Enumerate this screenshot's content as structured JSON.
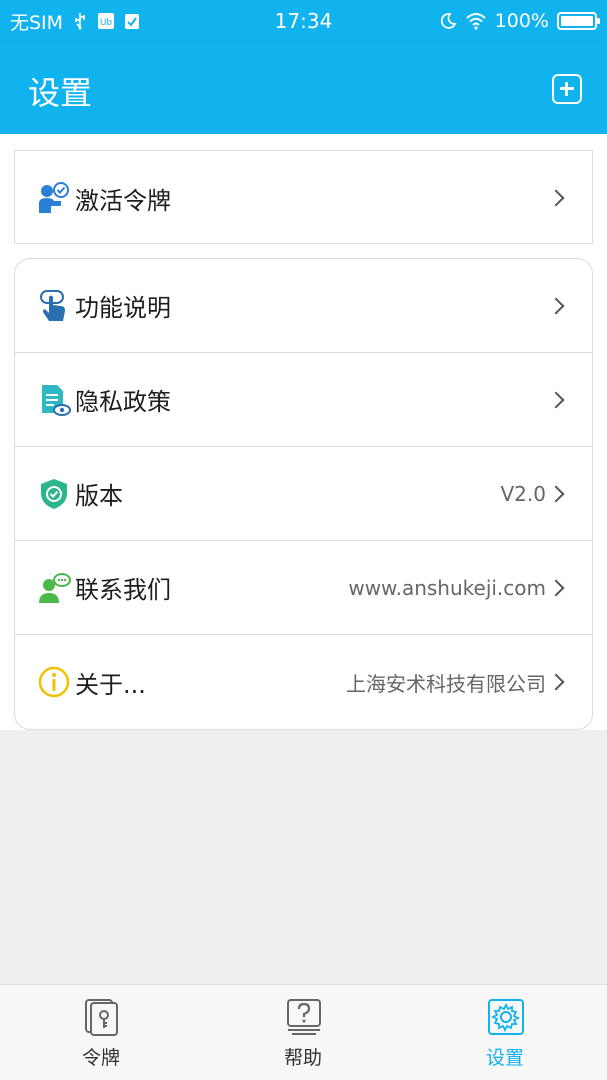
{
  "status_bar": {
    "carrier": "无SIM",
    "time": "17:34",
    "battery": "100%"
  },
  "header": {
    "title": "设置",
    "add_icon": "plus-square-icon"
  },
  "settings": {
    "activate": {
      "label": "激活令牌",
      "icon": "activate-token-icon"
    },
    "items": [
      {
        "label": "功能说明",
        "value": "",
        "icon": "touch-hand-icon"
      },
      {
        "label": "隐私政策",
        "value": "",
        "icon": "document-eye-icon"
      },
      {
        "label": "版本",
        "value": "V2.0",
        "icon": "shield-check-icon"
      },
      {
        "label": "联系我们",
        "value": "www.anshukeji.com",
        "icon": "contact-user-icon"
      },
      {
        "label": "关于...",
        "value": "上海安术科技有限公司",
        "icon": "info-icon"
      }
    ]
  },
  "tabbar": {
    "tabs": [
      {
        "label": "令牌",
        "icon": "token-card-icon",
        "active": false
      },
      {
        "label": "帮助",
        "icon": "help-book-icon",
        "active": false
      },
      {
        "label": "设置",
        "icon": "gear-icon",
        "active": true
      }
    ]
  },
  "colors": {
    "brand": "#10b3ee",
    "page_bg": "#efefef",
    "text": "#1e1e1e",
    "muted": "#666666"
  }
}
